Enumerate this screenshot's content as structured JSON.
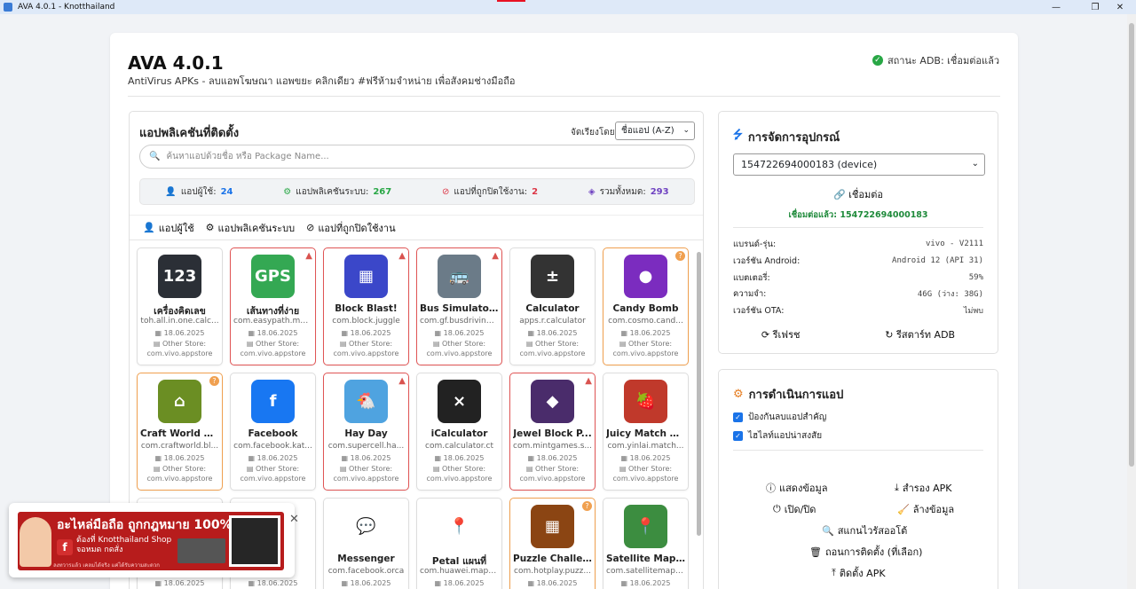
{
  "window": {
    "title": "AVA 4.0.1 - Knotthailand",
    "min": "—",
    "max": "❐",
    "close": "✕"
  },
  "header": {
    "title": "AVA 4.0.1",
    "subtitle": "AntiVirus APKs - ลบแอพโฆษณา แอพขยะ คลิกเดียว #ฟรีห้ามจำหน่าย เพื่อสังคมช่างมือถือ",
    "adb_status": "สถานะ ADB: เชื่อมต่อแล้ว"
  },
  "apps": {
    "title": "แอปพลิเคชันที่ติดตั้ง",
    "sort_label": "จัดเรียงโดย:",
    "sort_value": "ชื่อแอป (A-Z)",
    "search_placeholder": "ค้นหาแอปด้วยชื่อ หรือ Package Name...",
    "stats": [
      {
        "label": "แอปผู้ใช้:",
        "value": "24",
        "color": "#1a73e8",
        "icon": "user-icon"
      },
      {
        "label": "แอปพลิเคชันระบบ:",
        "value": "267",
        "color": "#28a745",
        "icon": "gear-icon"
      },
      {
        "label": "แอปที่ถูกปิดใช้งาน:",
        "value": "2",
        "color": "#dc3545",
        "icon": "ban-icon"
      },
      {
        "label": "รวมทั้งหมด:",
        "value": "293",
        "color": "#6f42c1",
        "icon": "cubes-icon"
      }
    ],
    "tabs": [
      "แอปผู้ใช้",
      "แอปพลิเคชันระบบ",
      "แอปที่ถูกปิดใช้งาน"
    ],
    "store_label": "Other Store:",
    "items": [
      {
        "name": "เครื่องคิดเลข",
        "pkg": "toh.all.in.one.calc...",
        "date": "18.06.2025",
        "store": "com.vivo.appstore",
        "flag": "",
        "bg": "#2b2f36",
        "glyph": "123"
      },
      {
        "name": "เส้นทางที่ง่าย",
        "pkg": "com.easypath.ma...",
        "date": "18.06.2025",
        "store": "com.vivo.appstore",
        "flag": "warn",
        "bg": "#34a853",
        "glyph": "GPS"
      },
      {
        "name": "Block Blast!",
        "pkg": "com.block.juggle",
        "date": "18.06.2025",
        "store": "com.vivo.appstore",
        "flag": "warn",
        "bg": "#3b47c9",
        "glyph": "▦"
      },
      {
        "name": "Bus Simulator ...",
        "pkg": "com.gf.busdrivingg...",
        "date": "18.06.2025",
        "store": "com.vivo.appstore",
        "flag": "warn",
        "bg": "#6b7b88",
        "glyph": "🚌"
      },
      {
        "name": "Calculator",
        "pkg": "apps.r.calculator",
        "date": "18.06.2025",
        "store": "com.vivo.appstore",
        "flag": "",
        "bg": "#333",
        "glyph": "±"
      },
      {
        "name": "Candy Bomb",
        "pkg": "com.cosmo.cand...",
        "date": "18.06.2025",
        "store": "com.vivo.appstore",
        "flag": "q",
        "bg": "#7b2cbf",
        "glyph": "●"
      },
      {
        "name": "Craft World Bl...",
        "pkg": "com.craftworld.bl...",
        "date": "18.06.2025",
        "store": "com.vivo.appstore",
        "flag": "q",
        "bg": "#6b8e23",
        "glyph": "⌂"
      },
      {
        "name": "Facebook",
        "pkg": "com.facebook.kat...",
        "date": "18.06.2025",
        "store": "com.vivo.appstore",
        "flag": "",
        "bg": "#1877f2",
        "glyph": "f"
      },
      {
        "name": "Hay Day",
        "pkg": "com.supercell.ha...",
        "date": "18.06.2025",
        "store": "com.vivo.appstore",
        "flag": "warn",
        "bg": "#4fa3e0",
        "glyph": "🐔"
      },
      {
        "name": "iCalculator",
        "pkg": "com.calculator.ct",
        "date": "18.06.2025",
        "store": "com.vivo.appstore",
        "flag": "",
        "bg": "#222",
        "glyph": "×"
      },
      {
        "name": "Jewel Block P...",
        "pkg": "com.mintgames.s...",
        "date": "18.06.2025",
        "store": "com.vivo.appstore",
        "flag": "warn",
        "bg": "#4a2c6b",
        "glyph": "◆"
      },
      {
        "name": "Juicy Match G...",
        "pkg": "com.yinlai.match...",
        "date": "18.06.2025",
        "store": "com.vivo.appstore",
        "flag": "",
        "bg": "#c0392b",
        "glyph": "🍓"
      },
      {
        "name": "",
        "pkg": "",
        "date": "18.06.2025",
        "store": "",
        "flag": "",
        "bg": "#fff",
        "glyph": ""
      },
      {
        "name": "",
        "pkg": "...ct",
        "date": "18.06.2025",
        "store": "",
        "flag": "",
        "bg": "#fff",
        "glyph": ""
      },
      {
        "name": "Messenger",
        "pkg": "com.facebook.orca",
        "date": "18.06.2025",
        "store": "",
        "flag": "",
        "bg": "#fff",
        "glyph": "💬"
      },
      {
        "name": "Petal แผนที่",
        "pkg": "com.huawei.maps...",
        "date": "18.06.2025",
        "store": "",
        "flag": "",
        "bg": "#fff",
        "glyph": "📍"
      },
      {
        "name": "Puzzle Challen...",
        "pkg": "com.hotplay.puzz...",
        "date": "18.06.2025",
        "store": "",
        "flag": "q",
        "bg": "#8b4513",
        "glyph": "▦"
      },
      {
        "name": "Satellite Map ...",
        "pkg": "com.satellitemap....",
        "date": "18.06.2025",
        "store": "",
        "flag": "",
        "bg": "#3c8d40",
        "glyph": "📍"
      }
    ]
  },
  "device": {
    "title": "การจัดการอุปกรณ์",
    "selected": "154722694000183 (device)",
    "connect": "เชื่อมต่อ",
    "connected": "เชื่อมต่อแล้ว: 154722694000183",
    "info": [
      {
        "k": "แบรนด์-รุ่น:",
        "v": "vivo - V2111"
      },
      {
        "k": "เวอร์ชัน Android:",
        "v": "Android 12 (API 31)"
      },
      {
        "k": "แบตเตอรี่:",
        "v": "59%"
      },
      {
        "k": "ความจำ:",
        "v": "46G (ว่าง: 38G)"
      },
      {
        "k": "เวอร์ชัน OTA:",
        "v": "ไม่พบ"
      }
    ],
    "refresh": "รีเฟรช",
    "restart": "รีสตาร์ท ADB"
  },
  "actions": {
    "title": "การดำเนินการแอป",
    "protect": "ป้องกันลบแอปสำคัญ",
    "highlight": "ไฮไลท์แอปน่าสงสัย",
    "show_info": "แสดงข้อมูล",
    "backup": "สำรอง APK",
    "toggle": "เปิด/ปิด",
    "clear": "ล้างข้อมูล",
    "scan": "สแกนไวรัสออโต้",
    "uninstall": "ถอนการติดตั้ง (ที่เลือก)",
    "install": "ติดตั้ง APK"
  },
  "ad": {
    "headline": "อะไหล่มือถือ ถูกกฎหมาย 100%",
    "line1": "ต้องที่ Knotthailand Shop",
    "line2": "จอหมด กดสั่ง",
    "small": "ลงทวารแล้ว เคลมได้จริง แค่ได้รับความสะดวก",
    "fb": "f",
    "close": "✕"
  }
}
